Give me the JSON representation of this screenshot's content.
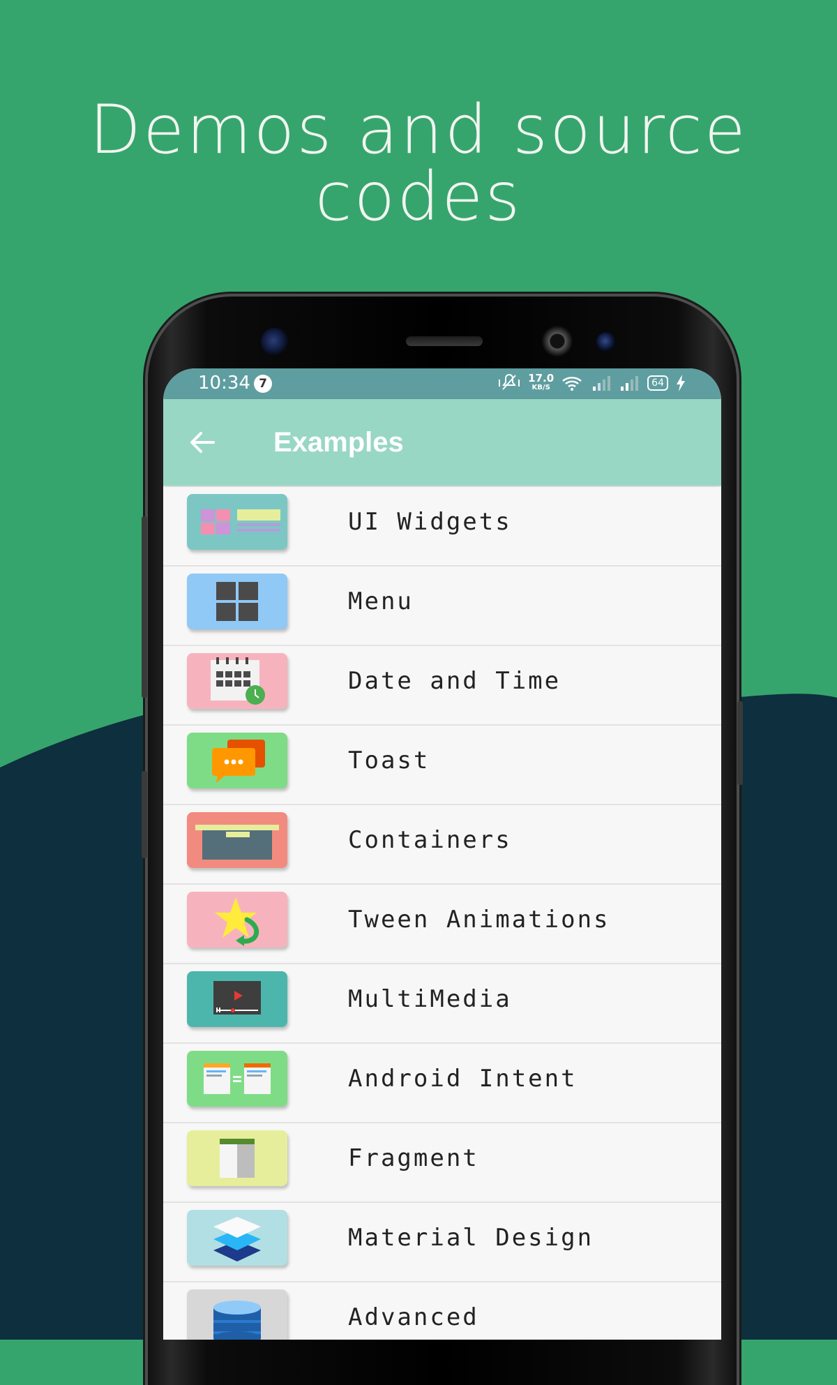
{
  "headline": {
    "line1": "Demos and source",
    "line2": "codes"
  },
  "colors": {
    "green": "#36a56d",
    "navy": "#0e2f3d",
    "app_bar": "#98d7c4",
    "status_bar": "#5f9ea0"
  },
  "status_bar": {
    "time": "10:34",
    "notification_count": "7",
    "net_speed": "17.0",
    "net_unit": "KB/S",
    "battery": "64",
    "icons": [
      "mute-vibrate-icon",
      "wifi-icon",
      "signal-icon",
      "signal-icon",
      "battery-icon",
      "charging-icon"
    ]
  },
  "app_bar": {
    "title": "Examples",
    "back_icon": "arrow-left-icon"
  },
  "items": [
    {
      "label": "UI Widgets",
      "icon": "ui-widgets-icon",
      "tile_color": "#7cc7c4"
    },
    {
      "label": "Menu",
      "icon": "menu-grid-icon",
      "tile_color": "#90c8f6"
    },
    {
      "label": "Date and Time",
      "icon": "calendar-clock-icon",
      "tile_color": "#f7b3bd"
    },
    {
      "label": "Toast",
      "icon": "chat-bubbles-icon",
      "tile_color": "#7fdc86"
    },
    {
      "label": "Containers",
      "icon": "container-box-icon",
      "tile_color": "#f28b7f"
    },
    {
      "label": "Tween Animations",
      "icon": "star-rotate-icon",
      "tile_color": "#f7b3bd"
    },
    {
      "label": "MultiMedia",
      "icon": "video-player-icon",
      "tile_color": "#4db6ac"
    },
    {
      "label": "Android Intent",
      "icon": "intent-screens-icon",
      "tile_color": "#7fdc86"
    },
    {
      "label": "Fragment",
      "icon": "fragment-layout-icon",
      "tile_color": "#e6ee9c"
    },
    {
      "label": "Material Design",
      "icon": "layers-icon",
      "tile_color": "#b2dfe4"
    },
    {
      "label": "Advanced",
      "icon": "database-icon",
      "tile_color": "#d7d7d7"
    }
  ]
}
